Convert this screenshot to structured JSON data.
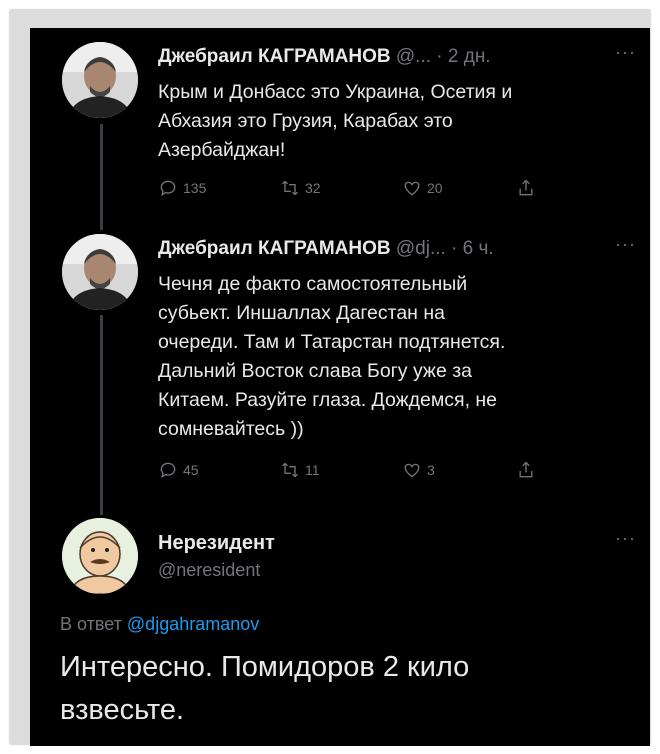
{
  "tweets": [
    {
      "name": "Джебраил КАГРАМАНОВ",
      "handle": "@...",
      "time": "· 2 дн.",
      "more": "···",
      "lines": [
        "Крым и Донбасс это Украина, Осетия и",
        "Абхазия это Грузия, Карабах это",
        "Азербайджан!"
      ],
      "replies": "135",
      "retweets": "32",
      "likes": "20"
    },
    {
      "name": "Джебраил КАГРАМАНОВ",
      "handle": "@dj...",
      "time": "· 6 ч.",
      "more": "···",
      "lines": [
        "Чечня де факто самостоятельный",
        "субьект. Иншаллах Дагестан на",
        "очереди. Там и Татарстан подтянется.",
        "Дальний Восток слава Богу уже за",
        "Китаем. Разуйте глаза. Дождемся, не",
        "сомневайтесь ))"
      ],
      "replies": "45",
      "retweets": "11",
      "likes": "3"
    }
  ],
  "reply": {
    "name": "Нерезидент",
    "handle": "@neresident",
    "more": "···",
    "reply_prefix": "В ответ",
    "reply_handle": "@djgahramanov",
    "lines": [
      "Интересно. Помидоров 2 кило",
      "взвесьте."
    ]
  },
  "colors": {
    "background": "#000000",
    "text": "#e7e9ea",
    "muted": "#71767b",
    "link": "#1d9bf0"
  },
  "icons": [
    "reply-icon",
    "retweet-icon",
    "like-icon",
    "share-icon",
    "more-icon"
  ]
}
